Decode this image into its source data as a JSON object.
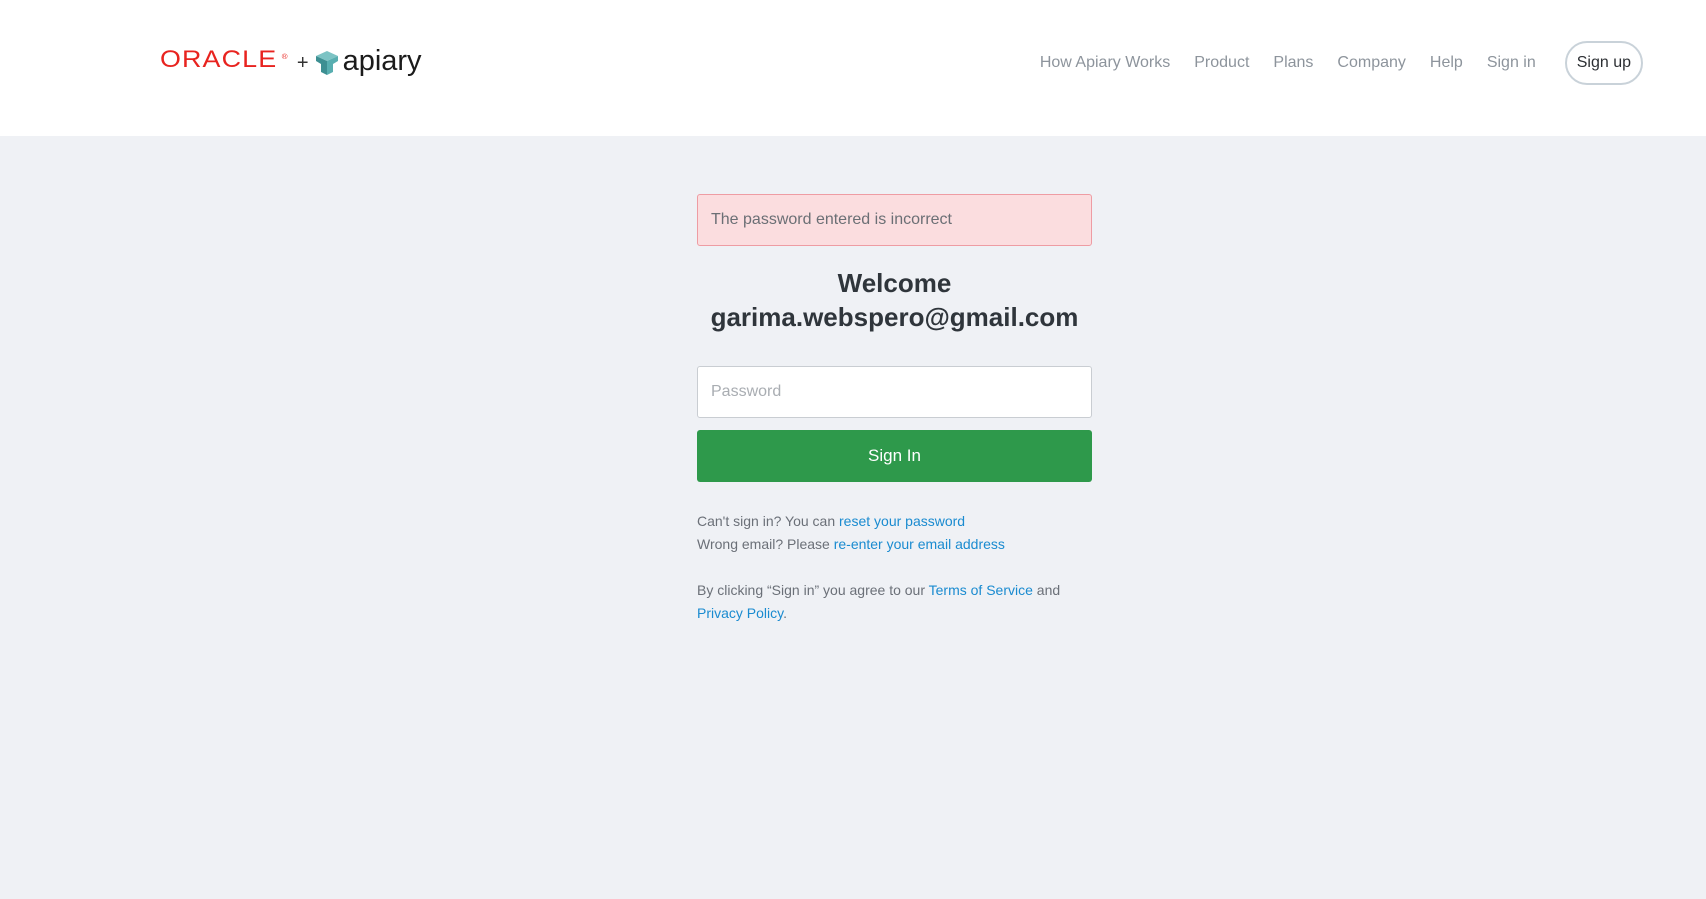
{
  "header": {
    "logo": {
      "oracle_text": "ORACLE",
      "registered_mark": "®",
      "plus": "+",
      "apiary_text": "apiary"
    },
    "nav": {
      "items": [
        {
          "label": "How Apiary Works"
        },
        {
          "label": "Product"
        },
        {
          "label": "Plans"
        },
        {
          "label": "Company"
        },
        {
          "label": "Help"
        },
        {
          "label": "Sign in"
        }
      ],
      "signup_label": "Sign up"
    }
  },
  "signin": {
    "alert": "The password entered is incorrect",
    "welcome_line1": "Welcome",
    "welcome_line2": "garima.webspero@gmail.com",
    "password_placeholder": "Password",
    "password_value": "",
    "submit_label": "Sign In",
    "help": {
      "cant_signin_prefix": "Can't sign in? You can ",
      "reset_link": "reset your password",
      "wrong_email_prefix": "Wrong email? Please ",
      "reenter_link": "re-enter your email address"
    },
    "terms": {
      "prefix": "By clicking “Sign in” you agree to our ",
      "tos_link": "Terms of Service",
      "and": " and",
      "privacy_link": "Privacy Policy",
      "period": "."
    }
  },
  "colors": {
    "oracle_red": "#e8231f",
    "apiary_teal": "#4fa3a5",
    "alert_bg": "#fbdddf",
    "alert_border": "#ee9ca3",
    "signin_green": "#2e994b",
    "link_blue": "#1a8bd0",
    "page_bg": "#eff1f5"
  }
}
